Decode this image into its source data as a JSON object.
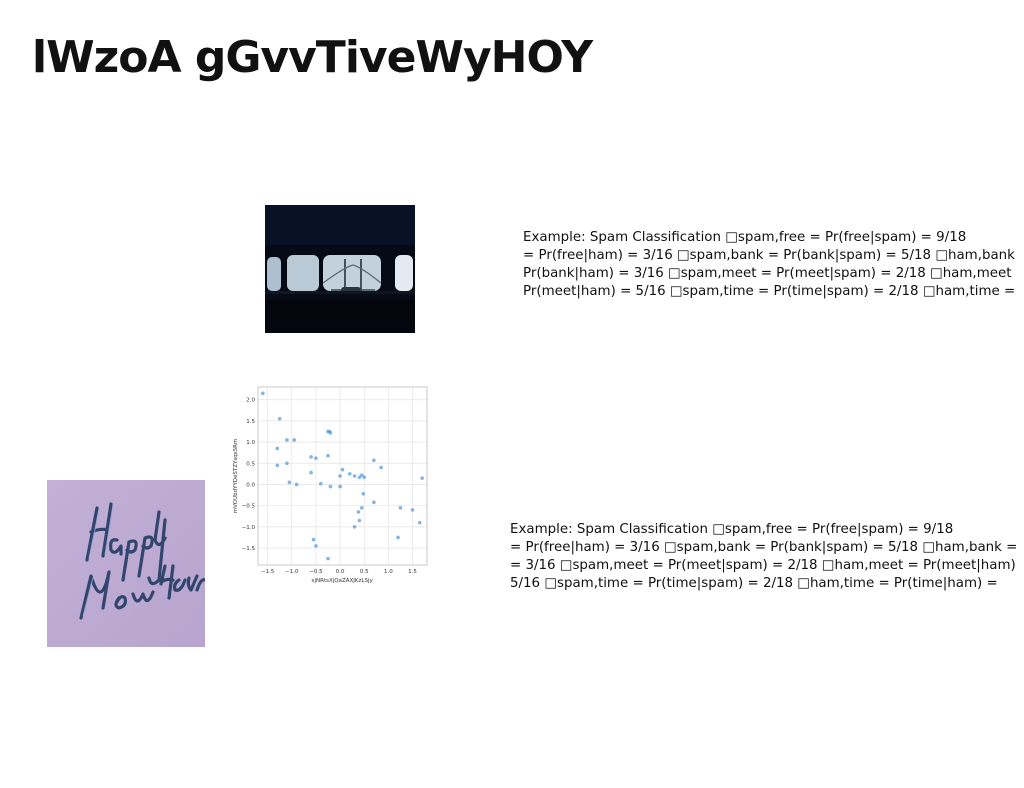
{
  "title": "lWzoA gGvvTiveWyHOY",
  "text_blocks": [
    {
      "lines": [
        "Example: Spam Classification □spam,free = Pr(free|spam) = 9/18",
        "= Pr(free|ham) = 3/16 □spam,bank = Pr(bank|spam) = 5/18 □ham,bank",
        "Pr(bank|ham) = 3/16 □spam,meet = Pr(meet|spam) = 2/18 □ham,meet",
        "Pr(meet|ham) = 5/16 □spam,time = Pr(time|spam) = 2/18 □ham,time ="
      ]
    },
    {
      "lines": [
        "Example: Spam Classification □spam,free = Pr(free|spam) = 9/18",
        "= Pr(free|ham) = 3/16 □spam,bank = Pr(bank|spam) = 5/18 □ham,bank =",
        "= 3/16 □spam,meet = Pr(meet|spam) = 2/18 □ham,meet = Pr(meet|ham)",
        "5/16 □spam,time = Pr(time|spam) = 2/18 □ham,time = Pr(time|ham) ="
      ]
    }
  ],
  "images": {
    "train_window": {
      "description_icon": "photo-train-window"
    },
    "new_year": {
      "lettering": "Happy New Year"
    }
  },
  "scatter_plot": {
    "xlabel": "xjNRtsXjQaZAXJKzLSjy",
    "ylabel": "mVOUbdYYDeSTZYsqsSRm",
    "x_ticks": [
      "−1.5",
      "−1.0",
      "−0.5",
      "0.0",
      "0.5",
      "1.0",
      "1.5"
    ],
    "y_ticks": [
      "2.0",
      "1.5",
      "1.0",
      "0.5",
      "0.0",
      "−0.5",
      "−1.0",
      "−1.5"
    ],
    "chart_data": {
      "type": "scatter",
      "xlim": [
        -1.7,
        1.8
      ],
      "ylim": [
        -1.9,
        2.3
      ],
      "grid": true,
      "color": "#5b9bd5",
      "points": [
        [
          -1.6,
          2.15
        ],
        [
          -1.25,
          1.55
        ],
        [
          -1.3,
          0.85
        ],
        [
          -1.1,
          1.05
        ],
        [
          -0.95,
          1.05
        ],
        [
          -1.1,
          0.5
        ],
        [
          -1.3,
          0.45
        ],
        [
          -0.6,
          0.65
        ],
        [
          -0.5,
          0.62
        ],
        [
          -0.25,
          1.25
        ],
        [
          -0.2,
          1.22
        ],
        [
          -0.22,
          1.25
        ],
        [
          -0.25,
          0.68
        ],
        [
          -0.6,
          0.28
        ],
        [
          -1.05,
          0.05
        ],
        [
          -0.9,
          0.0
        ],
        [
          -0.4,
          0.02
        ],
        [
          -0.2,
          -0.05
        ],
        [
          0.0,
          0.2
        ],
        [
          0.05,
          0.35
        ],
        [
          0.2,
          0.25
        ],
        [
          0.3,
          0.2
        ],
        [
          0.45,
          0.22
        ],
        [
          0.5,
          0.17
        ],
        [
          0.7,
          0.57
        ],
        [
          0.85,
          0.4
        ],
        [
          0.48,
          -0.22
        ],
        [
          0.45,
          -0.55
        ],
        [
          0.38,
          -0.65
        ],
        [
          0.4,
          -0.85
        ],
        [
          0.3,
          -1.0
        ],
        [
          0.7,
          -0.42
        ],
        [
          1.25,
          -0.55
        ],
        [
          1.5,
          -0.6
        ],
        [
          1.65,
          -0.9
        ],
        [
          1.2,
          -1.25
        ],
        [
          1.7,
          0.15
        ],
        [
          -0.55,
          -1.3
        ],
        [
          -0.5,
          -1.45
        ],
        [
          -0.25,
          -1.75
        ],
        [
          0.0,
          -0.05
        ],
        [
          0.4,
          0.17
        ]
      ]
    }
  }
}
